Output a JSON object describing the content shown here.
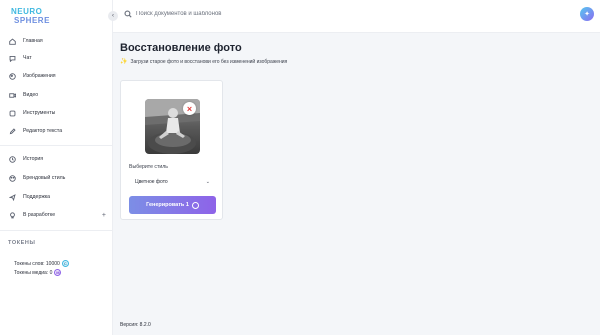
{
  "logo": {
    "line1": "NEURO",
    "line2": "SPHERE"
  },
  "search": {
    "placeholder": "Поиск документов и шаблонов"
  },
  "sidebar": {
    "items": [
      {
        "label": "Главная",
        "icon": "home-icon"
      },
      {
        "label": "Чат",
        "icon": "chat-icon"
      },
      {
        "label": "Изображения",
        "icon": "image-icon"
      },
      {
        "label": "Видео",
        "icon": "video-icon"
      },
      {
        "label": "Инструменты",
        "icon": "tools-icon"
      },
      {
        "label": "Редактор текста",
        "icon": "pencil-icon"
      },
      {
        "label": "История",
        "icon": "history-icon"
      },
      {
        "label": "Брендовый стиль",
        "icon": "palette-icon"
      },
      {
        "label": "Поддержка",
        "icon": "support-icon"
      },
      {
        "label": "В разработке",
        "icon": "bulb-icon"
      }
    ],
    "dev_plus": "+",
    "tokens_title": "ТОКЕНЫ",
    "tokens_words": "Токены слов: 10000",
    "tokens_words_badge": "C",
    "tokens_media": "Токены медиа: 0",
    "tokens_media_badge": "M",
    "version": "Версия: 8.2.0"
  },
  "main": {
    "title": "Восстановление фото",
    "subtitle": "Загрузи старое фото и восстанови его без изменений изображения",
    "style_label": "Выберите стиль",
    "style_selected": "Цветное фото",
    "generate_label": "Генерировать 1"
  },
  "colors": {
    "accent_start": "#7c8ee6",
    "accent_end": "#8e63e8",
    "danger": "#e23c3c"
  }
}
